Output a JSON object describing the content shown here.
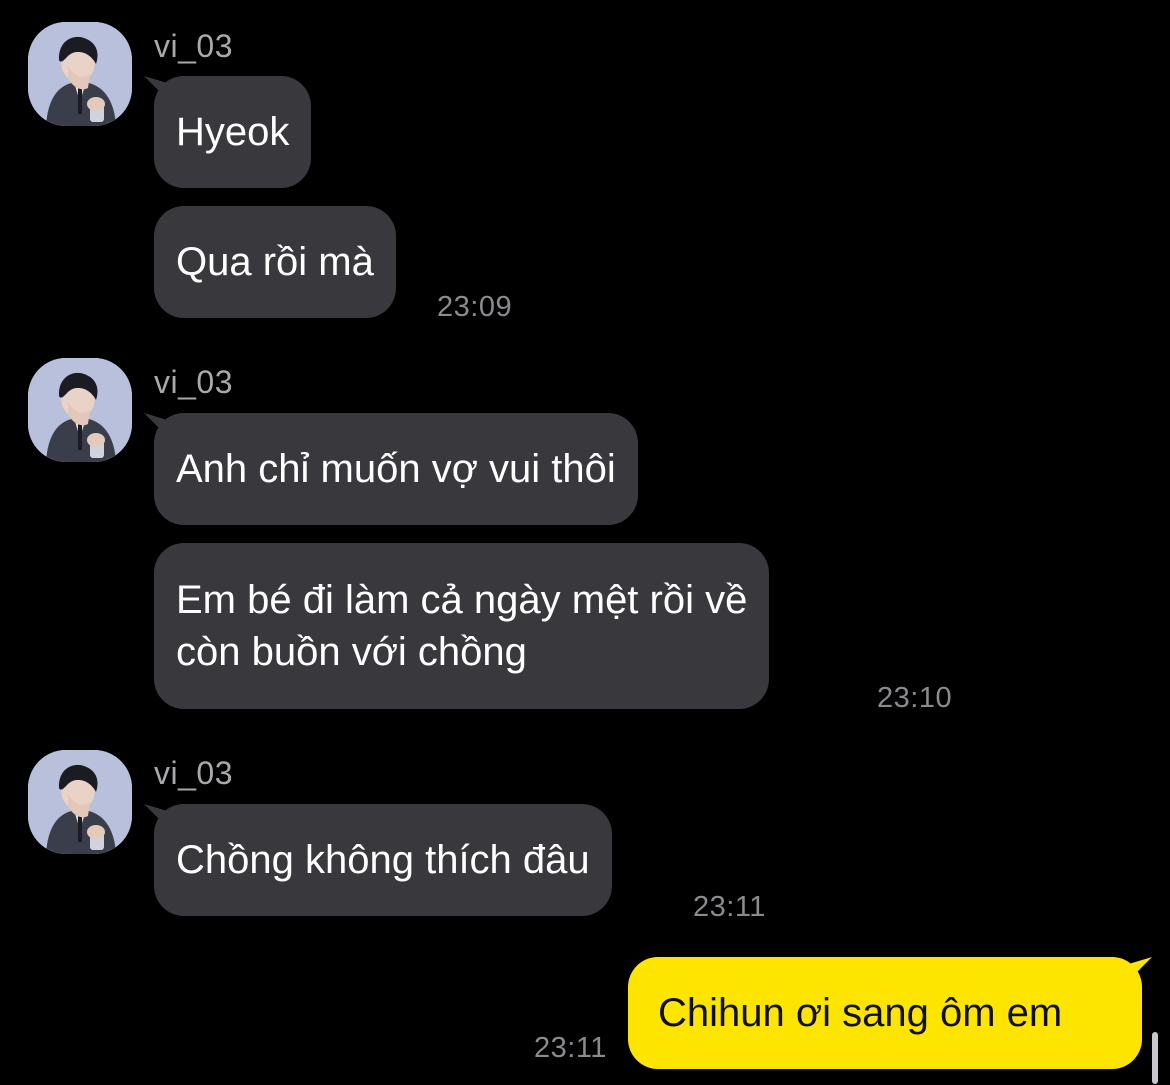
{
  "colors": {
    "background": "#000000",
    "incoming_bubble": "#39393d",
    "outgoing_bubble": "#fee500",
    "sender_name": "#a9a9ad",
    "timestamp": "#8a8a8f"
  },
  "groups": [
    {
      "sender": "vi_03",
      "avatar_icon": "profile-photo",
      "messages": [
        "Hyeok",
        "Qua rồi mà"
      ],
      "time": "23:09"
    },
    {
      "sender": "vi_03",
      "avatar_icon": "profile-photo",
      "messages": [
        "Anh chỉ muốn vợ vui thôi",
        "Em bé đi làm cả ngày mệt rồi về\ncòn buồn với chồng"
      ],
      "message_lines": [
        "Em bé đi làm cả ngày mệt rồi về",
        "còn buồn với chồng"
      ],
      "time": "23:10"
    },
    {
      "sender": "vi_03",
      "avatar_icon": "profile-photo",
      "messages": [
        "Chồng không thích đâu"
      ],
      "time": "23:11"
    }
  ],
  "outgoing": {
    "message": "Chihun ơi sang ôm em",
    "time": "23:11"
  }
}
